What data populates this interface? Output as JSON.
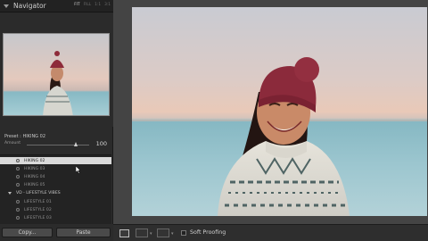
{
  "navigator": {
    "title": "Navigator",
    "zoom_options": [
      "FIT",
      "FILL",
      "1:1",
      "3:1"
    ]
  },
  "preset_panel": {
    "preset_label": "Preset : HIKING 02",
    "amount_label": "Amount",
    "amount_value": "100",
    "amount_fraction": 0.79,
    "items": [
      {
        "type": "preset",
        "label": "HIKING 02",
        "selected": true
      },
      {
        "type": "preset",
        "label": "HIKING 03",
        "selected": false
      },
      {
        "type": "preset",
        "label": "HIKING 04",
        "selected": false
      },
      {
        "type": "preset",
        "label": "HIKING 05",
        "selected": false
      },
      {
        "type": "group",
        "label": "VD - LIFESTYLE VIBES"
      },
      {
        "type": "preset",
        "label": "LIFESTYLE 01",
        "selected": false
      },
      {
        "type": "preset",
        "label": "LIFESTYLE 02",
        "selected": false
      },
      {
        "type": "preset",
        "label": "LIFESTYLE 03",
        "selected": false
      }
    ]
  },
  "buttons": {
    "copy_label": "Copy...",
    "paste_label": "Paste"
  },
  "toolbar": {
    "soft_proofing_label": "Soft Proofing"
  },
  "colors": {
    "panel_bg": "#2b2b2b",
    "selected_row": "#d9d9d9",
    "accent_text": "#cfcfcf"
  }
}
